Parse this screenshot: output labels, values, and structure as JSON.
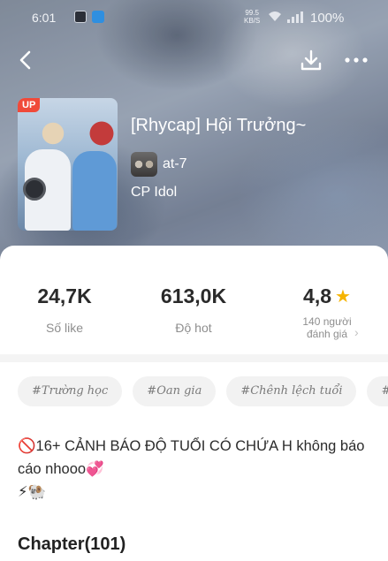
{
  "status_bar": {
    "time": "6:01",
    "net_speed_value": "99.5",
    "net_speed_unit": "KB/S",
    "battery": "100%"
  },
  "header": {
    "icons": [
      "back-arrow-icon",
      "download-icon",
      "more-dots-icon"
    ]
  },
  "story": {
    "badge": "UP",
    "title": "[Rhycap] Hội Trưởng~",
    "author": "at-7",
    "category": "CP Idol"
  },
  "stats": {
    "likes_value": "24,7K",
    "likes_label": "Số like",
    "hot_value": "613,0K",
    "hot_label": "Độ hot",
    "rating_value": "4,8",
    "rating_label_line1": "140 người",
    "rating_label_line2": "đánh giá"
  },
  "tags": [
    "#Trường học",
    "#Oan gia",
    "#Chênh lệch tuổi",
    "#ABO"
  ],
  "description": {
    "line1": "🚫16+ CẢNH BÁO ĐỘ TUỔI CÓ CHỨA H  không báo cáo nhooo💞",
    "line2": "⚡🐏"
  },
  "chapters": {
    "title": "Chapter(101)"
  },
  "colors": {
    "badge_red": "#f04a3a",
    "star_yellow": "#f6b400",
    "tag_bg": "#f2f2f2"
  }
}
